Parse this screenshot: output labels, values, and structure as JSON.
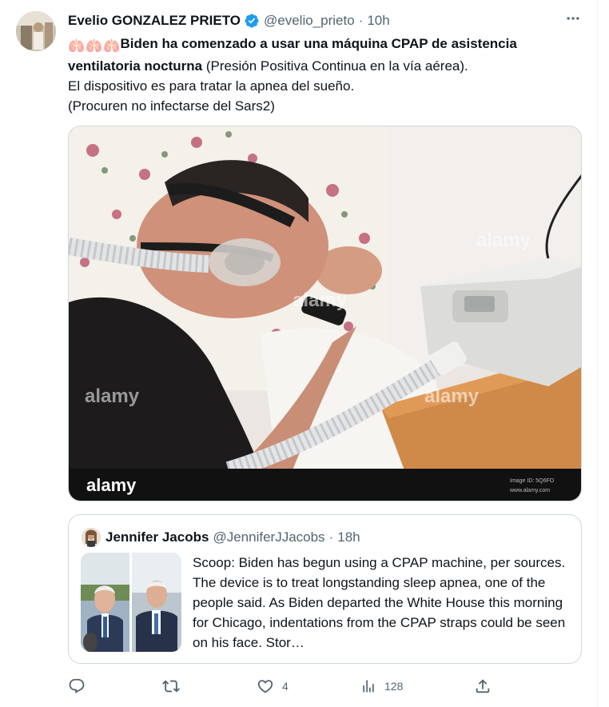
{
  "tweet": {
    "author": {
      "display_name": "Evelio GONZALEZ PRIETO",
      "handle": "@evelio_prieto",
      "verified": true,
      "avatar_icon": "user-avatar"
    },
    "separator": "·",
    "time": "10h",
    "more_icon": "more-horizontal-icon",
    "text": {
      "emoji": [
        "🫁",
        "🫁",
        "🫁"
      ],
      "bold_part": "Biden ha comenzado a usar una máquina CPAP de asistencia ventilatoria nocturna",
      "rest_part": " (Presión Positiva Continua en la vía aérea).",
      "line2": "El dispositivo es para tratar la apnea del sueño.",
      "line3": "(Procuren no infectarse del Sars2)"
    },
    "media": {
      "watermark": "alamy",
      "image_id": "Image ID: 5Q6FO",
      "site": "www.alamy.com"
    },
    "quote": {
      "author": {
        "display_name": "Jennifer Jacobs",
        "handle": "@JenniferJJacobs"
      },
      "separator": "·",
      "time": "18h",
      "text": "Scoop: Biden has begun using a CPAP machine, per sources. The device is to treat longstanding sleep apnea, one of the people said. As Biden departed the White House this morning for Chicago, indentations from the CPAP straps could be seen on his face. Stor…"
    },
    "actions": {
      "reply_count": "",
      "retweet_count": "",
      "like_count": "4",
      "views_count": "128"
    }
  },
  "colors": {
    "text_primary": "#0f1419",
    "text_secondary": "#536471",
    "verified_blue": "#1d9bf0",
    "border": "#cfd9de"
  }
}
